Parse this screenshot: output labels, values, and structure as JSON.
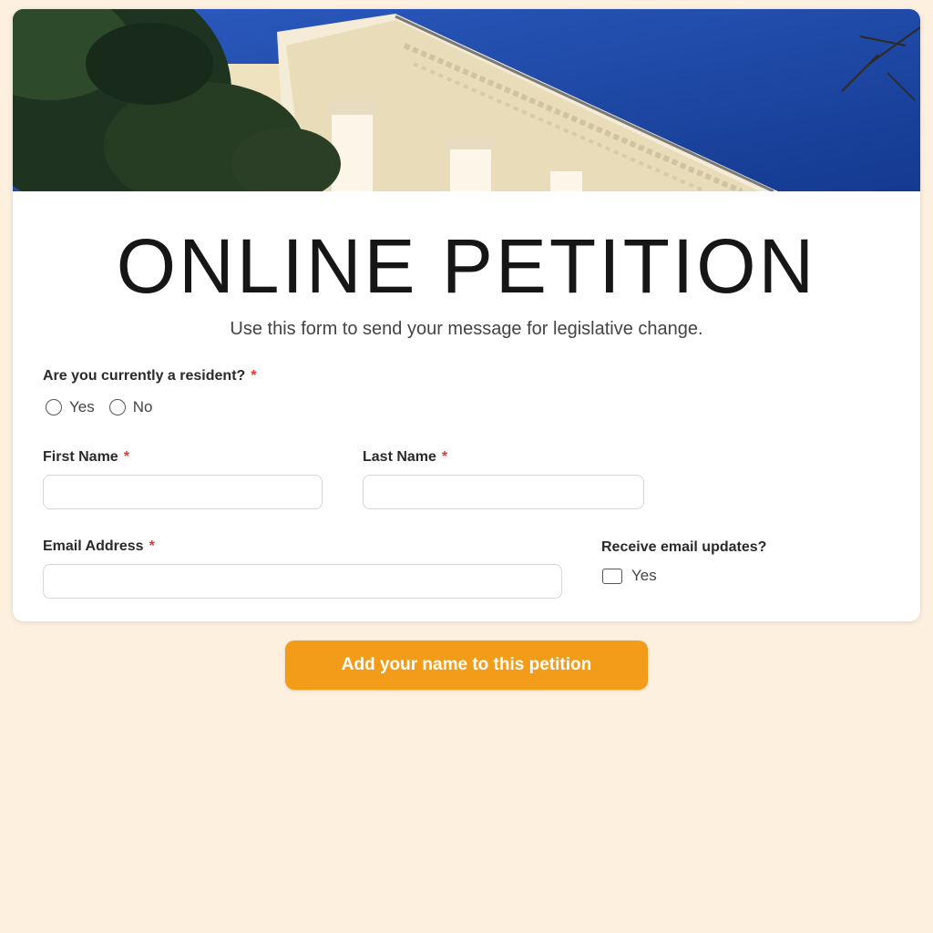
{
  "form": {
    "title": "ONLINE PETITION",
    "subtitle": "Use this form to send your message for legislative change.",
    "required_marker": "*",
    "resident_question": {
      "label": "Are you currently a resident?",
      "options": [
        "Yes",
        "No"
      ],
      "selected": null
    },
    "first_name": {
      "label": "First Name",
      "value": "",
      "placeholder": ""
    },
    "last_name": {
      "label": "Last Name",
      "value": "",
      "placeholder": ""
    },
    "email": {
      "label": "Email Address",
      "value": "",
      "placeholder": ""
    },
    "email_updates": {
      "label": "Receive email updates?",
      "option": "Yes",
      "checked": false
    },
    "submit_label": "Add your name to this petition"
  },
  "colors": {
    "page_background": "#fdf0df",
    "accent": "#f39c1a",
    "required": "#e53935",
    "sky": "#1f4aa8",
    "building": "#f2e8cf"
  },
  "icons": {
    "radio": "radio-circle-icon",
    "checkbox": "checkbox-icon"
  }
}
